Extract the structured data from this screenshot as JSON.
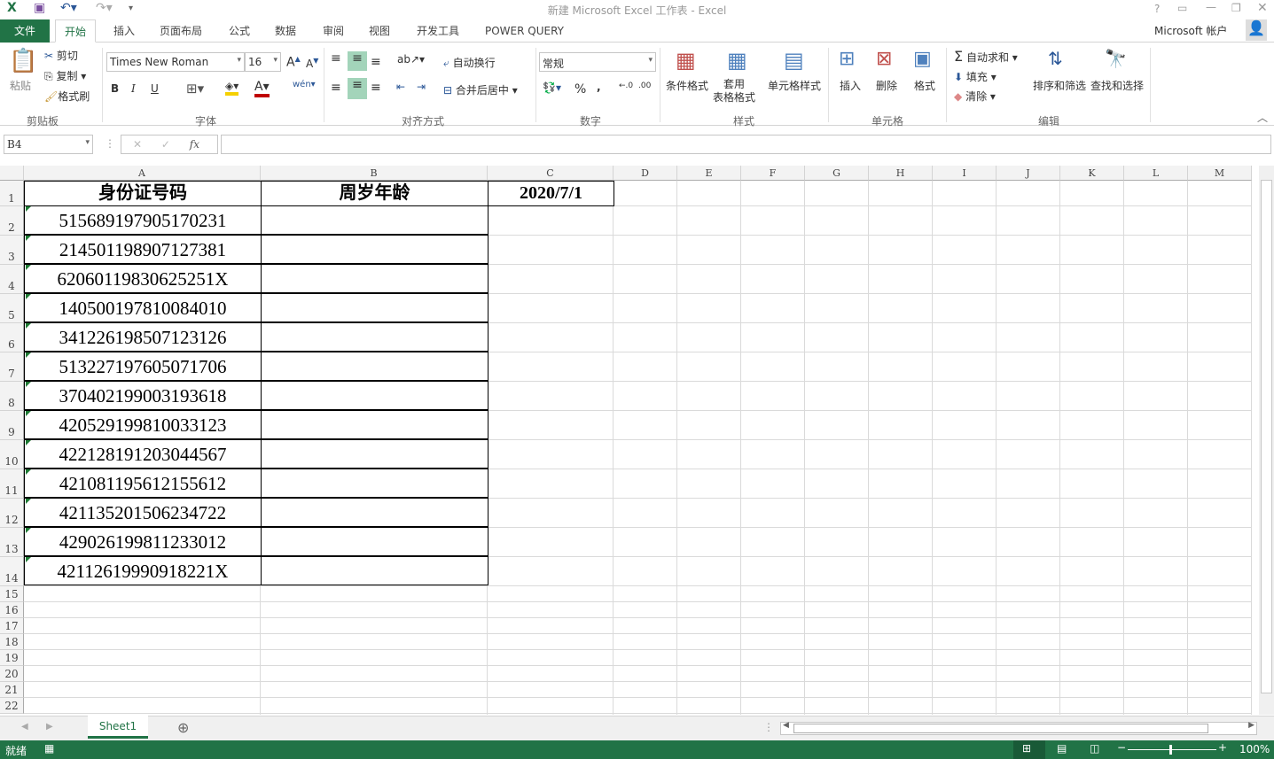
{
  "window": {
    "title": "新建 Microsoft Excel 工作表 - Excel",
    "help": "?",
    "account": "Microsoft 帐户"
  },
  "tabs": [
    "文件",
    "开始",
    "插入",
    "页面布局",
    "公式",
    "数据",
    "审阅",
    "视图",
    "开发工具",
    "POWER QUERY"
  ],
  "ribbon": {
    "clipboard": {
      "paste": "粘贴",
      "cut": "剪切",
      "copy": "复制",
      "format_painter": "格式刷",
      "group": "剪贴板"
    },
    "font": {
      "name": "Times New Roman",
      "size": "16",
      "bold": "B",
      "italic": "I",
      "underline": "U",
      "group": "字体"
    },
    "alignment": {
      "wrap": "自动换行",
      "merge": "合并后居中",
      "group": "对齐方式"
    },
    "number": {
      "format": "常规",
      "percent": "%",
      "comma": ",",
      "group": "数字"
    },
    "styles": {
      "conditional": "条件格式",
      "table": "套用\n表格格式",
      "cell_styles": "单元格样式",
      "group": "样式"
    },
    "cells": {
      "insert": "插入",
      "delete": "删除",
      "format": "格式",
      "group": "单元格"
    },
    "editing": {
      "autosum": "自动求和",
      "fill": "填充",
      "clear": "清除",
      "sort": "排序和筛选",
      "find": "查找和选择",
      "group": "编辑"
    }
  },
  "formula_bar": {
    "name_box": "B4",
    "fx": "fx",
    "value": ""
  },
  "columns": [
    "A",
    "B",
    "C",
    "D",
    "E",
    "F",
    "G",
    "H",
    "I",
    "J",
    "K",
    "L",
    "M"
  ],
  "headers": {
    "a1": "身份证号码",
    "b1": "周岁年龄",
    "c1": "2020/7/1"
  },
  "ids": [
    "515689197905170231",
    "214501198907127381",
    "62060119830625251X",
    "140500197810084010",
    "341226198507123126",
    "513227197605071706",
    "370402199003193618",
    "420529199810033123",
    "422128191203044567",
    "421081195612155612",
    "421135201506234722",
    "429026199811233012",
    "42112619990918221X"
  ],
  "rows": [
    "1",
    "2",
    "3",
    "4",
    "5",
    "6",
    "7",
    "8",
    "9",
    "10",
    "11",
    "12",
    "13",
    "14",
    "15",
    "16",
    "17",
    "18",
    "19",
    "20",
    "21",
    "22"
  ],
  "sheets": [
    "Sheet1"
  ],
  "status": {
    "ready": "就绪",
    "zoom": "100%"
  },
  "colors": {
    "accent": "#217346"
  }
}
